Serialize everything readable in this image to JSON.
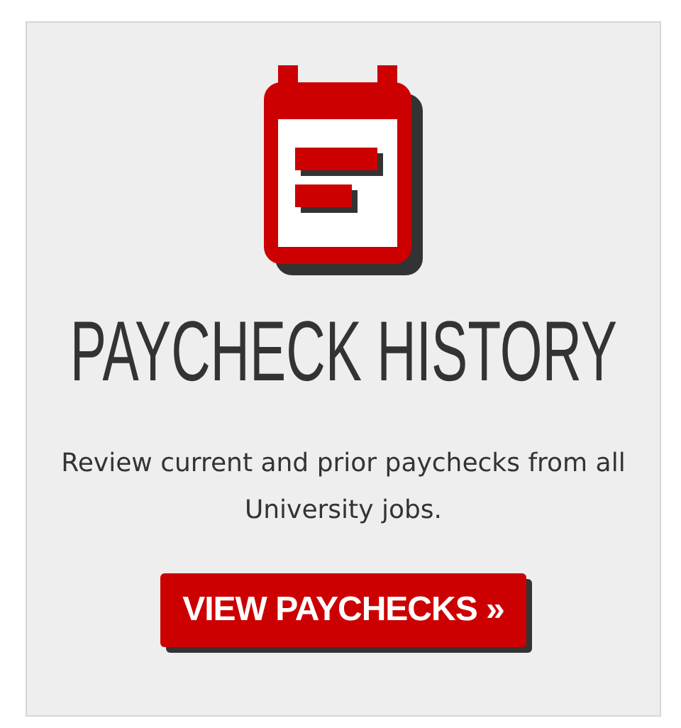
{
  "card": {
    "title": "PAYCHECK HISTORY",
    "description": "Review current and prior paychecks from all University jobs.",
    "button": "VIEW PAYCHECKS »"
  }
}
